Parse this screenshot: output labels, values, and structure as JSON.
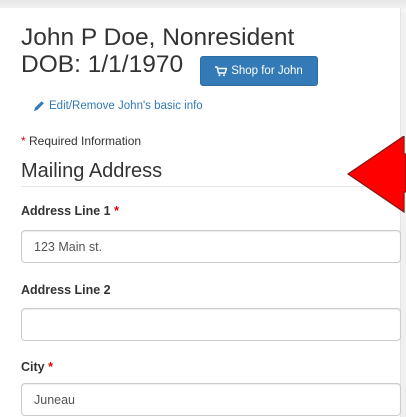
{
  "person": {
    "name_line": "John P Doe, Nonresident",
    "dob_line": "DOB: 1/1/1970"
  },
  "shop_button": {
    "label": "Shop for John",
    "icon": "cart-icon"
  },
  "edit_link": {
    "label": "Edit/Remove John's basic info",
    "icon": "pencil-icon"
  },
  "required_note": {
    "star": "*",
    "text": " Required Information"
  },
  "section_title": "Mailing Address",
  "fields": {
    "address_line_1": {
      "label": "Address Line 1",
      "required_star": "*",
      "value": "123 Main st."
    },
    "address_line_2": {
      "label": "Address Line 2",
      "value": ""
    },
    "city": {
      "label": "City",
      "required_star": "*",
      "value": "Juneau"
    }
  },
  "colors": {
    "primary_button": "#337ab7",
    "required_star": "#e00000",
    "annotation_arrow": "#ff0000"
  },
  "annotation": {
    "type": "arrow",
    "direction": "left",
    "icon": "red-arrow-icon"
  }
}
